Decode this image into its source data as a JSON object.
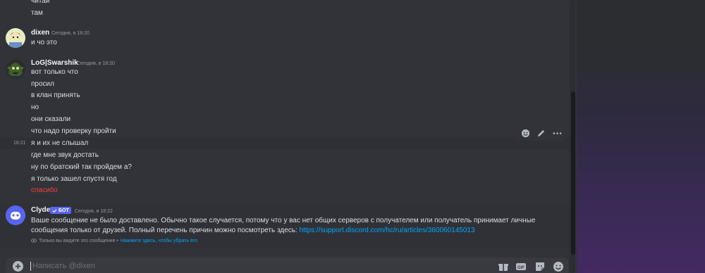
{
  "messages": {
    "prev_lines": [
      "читай",
      "там"
    ],
    "dixen": {
      "username": "dixen",
      "timestamp": "Сегодня, в 18:20",
      "lines": [
        "и чо это"
      ]
    },
    "swarshik": {
      "username": "LoG|Swarshik",
      "timestamp": "Сегодня, в 18:20",
      "lines": [
        "вот только что",
        "просил",
        "в клан принять",
        "но",
        "они сказали",
        "что надо проверку пройти",
        "я и их не слышал",
        "где мне звук достать",
        "ну по братский так пройдем а?",
        "я только зашел спустя год",
        "спасибо"
      ],
      "hover_time": "18:21",
      "failed_color": "#f23f43"
    },
    "clyde": {
      "username": "Clyde",
      "badge": "БОТ",
      "timestamp": "Сегодня, в 18:22",
      "text_line1": "Ваше сообщение не было доставлено. Обычно такое случается, потому что у вас нет общих серверов с получателем или получатель принимает личные",
      "text_line2": "сообщения только от друзей. Полный перечень причин можно посмотреть здесь: ",
      "link": "https://support.discord.com/hc/ru/articles/360060145013",
      "ephemeral_note": "Только вы видите это сообщение •",
      "dismiss": "Нажмите здесь, чтобы убрать его"
    }
  },
  "toolbar": {
    "icons": [
      "add-reaction-icon",
      "edit-icon",
      "more-icon"
    ]
  },
  "composer": {
    "placeholder": "Написать @dixen",
    "value": "",
    "gift_label": "gift-icon",
    "gif_label": "GIF",
    "sticker_label": "sticker-icon",
    "emoji_label": "emoji-icon"
  },
  "colors": {
    "accent": "#5865f2",
    "link": "#00a8fc",
    "error": "#f23f43"
  }
}
